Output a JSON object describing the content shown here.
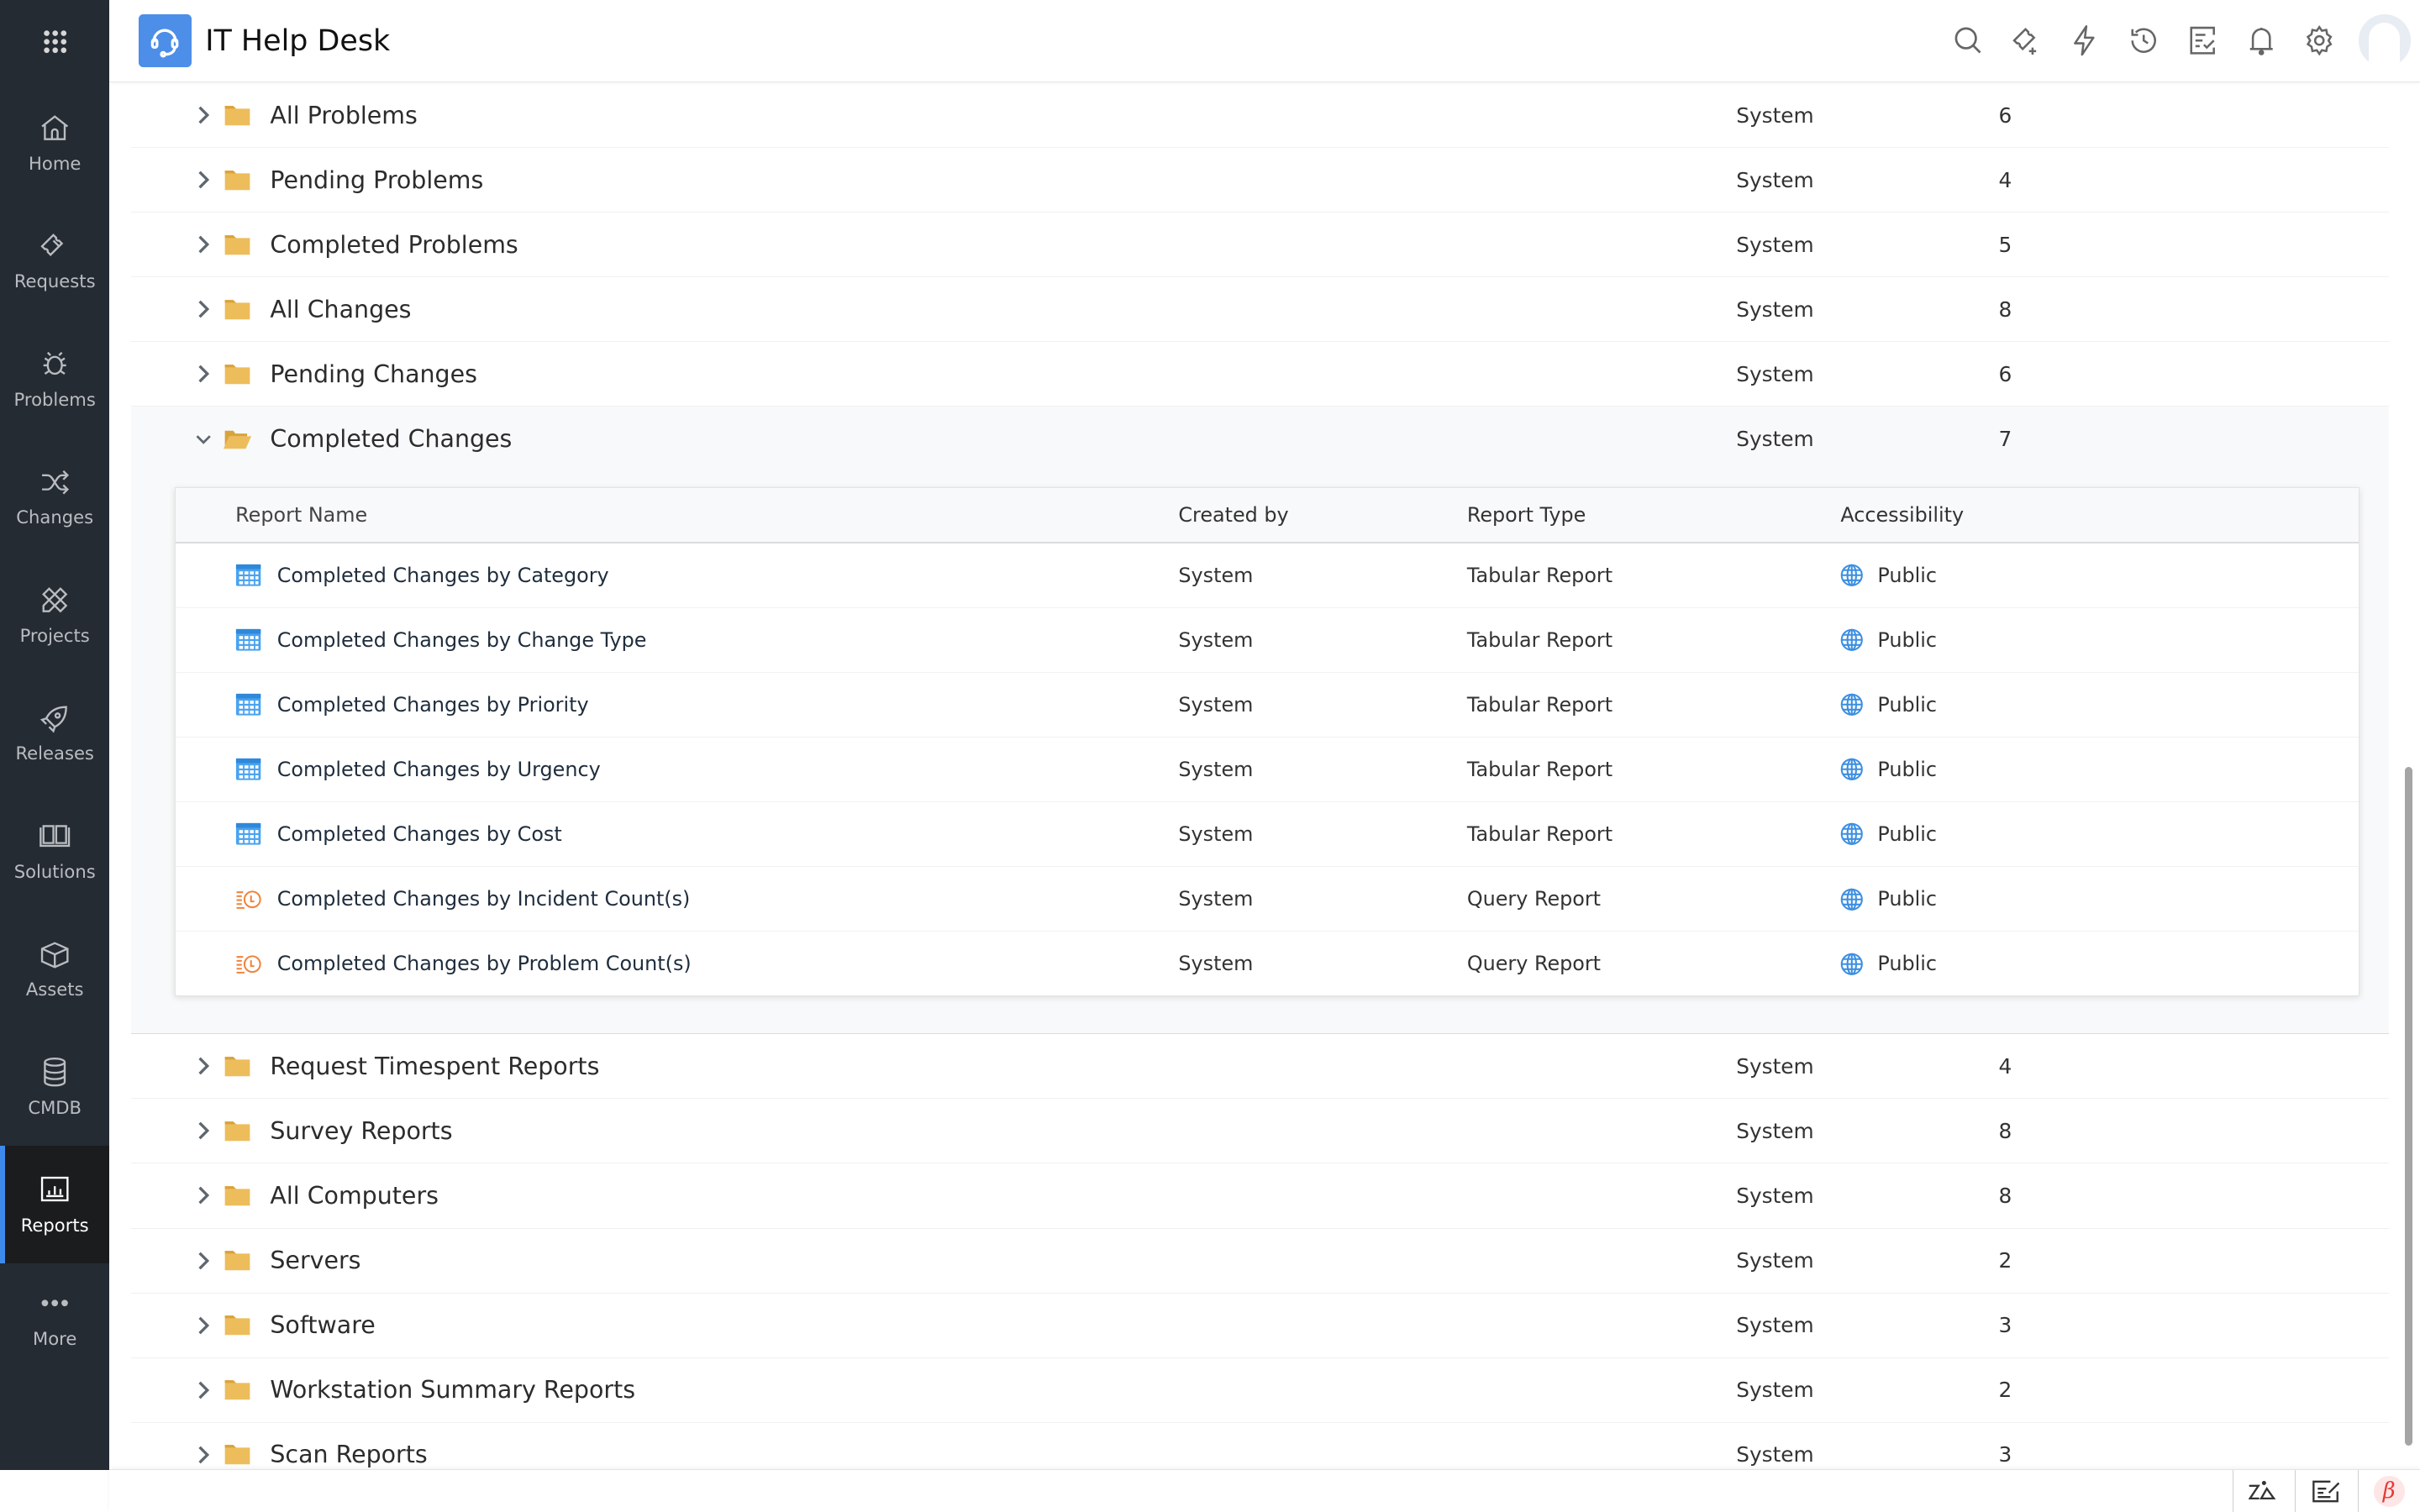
{
  "header": {
    "app_title": "IT Help Desk",
    "icons": [
      "search-icon",
      "new-request-icon",
      "quick-actions-icon",
      "history-icon",
      "tasks-icon",
      "notifications-icon",
      "settings-icon",
      "user-avatar"
    ]
  },
  "sidebar": {
    "items": [
      {
        "label": "Home",
        "icon": "home-icon"
      },
      {
        "label": "Requests",
        "icon": "ticket-icon"
      },
      {
        "label": "Problems",
        "icon": "bug-icon"
      },
      {
        "label": "Changes",
        "icon": "shuffle-icon"
      },
      {
        "label": "Projects",
        "icon": "pencil-ruler-icon"
      },
      {
        "label": "Releases",
        "icon": "rocket-icon"
      },
      {
        "label": "Solutions",
        "icon": "book-icon"
      },
      {
        "label": "Assets",
        "icon": "box-icon"
      },
      {
        "label": "CMDB",
        "icon": "database-icon"
      },
      {
        "label": "Reports",
        "icon": "report-chart-icon",
        "active": true
      },
      {
        "label": "More",
        "icon": "more-dots-icon"
      }
    ]
  },
  "folders_top": [
    {
      "name": "All Problems",
      "owner": "System",
      "count": "6"
    },
    {
      "name": "Pending Problems",
      "owner": "System",
      "count": "4"
    },
    {
      "name": "Completed Problems",
      "owner": "System",
      "count": "5"
    },
    {
      "name": "All Changes",
      "owner": "System",
      "count": "8"
    },
    {
      "name": "Pending Changes",
      "owner": "System",
      "count": "6"
    }
  ],
  "expanded_folder": {
    "name": "Completed Changes",
    "owner": "System",
    "count": "7",
    "columns": [
      "Report Name",
      "Created by",
      "Report Type",
      "Accessibility"
    ],
    "reports": [
      {
        "name": "Completed Changes by Category",
        "created_by": "System",
        "type": "Tabular Report",
        "accessibility": "Public",
        "icon": "tabular-report-icon"
      },
      {
        "name": "Completed Changes by Change Type",
        "created_by": "System",
        "type": "Tabular Report",
        "accessibility": "Public",
        "icon": "tabular-report-icon"
      },
      {
        "name": "Completed Changes by Priority",
        "created_by": "System",
        "type": "Tabular Report",
        "accessibility": "Public",
        "icon": "tabular-report-icon"
      },
      {
        "name": "Completed Changes by Urgency",
        "created_by": "System",
        "type": "Tabular Report",
        "accessibility": "Public",
        "icon": "tabular-report-icon"
      },
      {
        "name": "Completed Changes by Cost",
        "created_by": "System",
        "type": "Tabular Report",
        "accessibility": "Public",
        "icon": "tabular-report-icon"
      },
      {
        "name": "Completed Changes by Incident Count(s)",
        "created_by": "System",
        "type": "Query Report",
        "accessibility": "Public",
        "icon": "query-report-icon"
      },
      {
        "name": "Completed Changes by Problem Count(s)",
        "created_by": "System",
        "type": "Query Report",
        "accessibility": "Public",
        "icon": "query-report-icon"
      }
    ]
  },
  "folders_bottom": [
    {
      "name": "Request Timespent Reports",
      "owner": "System",
      "count": "4"
    },
    {
      "name": "Survey Reports",
      "owner": "System",
      "count": "8"
    },
    {
      "name": "All Computers",
      "owner": "System",
      "count": "8"
    },
    {
      "name": "Servers",
      "owner": "System",
      "count": "2"
    },
    {
      "name": "Software",
      "owner": "System",
      "count": "3"
    },
    {
      "name": "Workstation Summary Reports",
      "owner": "System",
      "count": "2"
    },
    {
      "name": "Scan Reports",
      "owner": "System",
      "count": "3"
    }
  ],
  "footer": {
    "buttons": [
      "zia-icon",
      "notes-icon",
      "beta-icon"
    ],
    "beta_label": "β"
  },
  "colors": {
    "sidebar_bg": "#252b33",
    "active_accent": "#3e8aeb",
    "folder": "#edbd5b",
    "tabular_icon": "#4aa3f0",
    "query_icon": "#f0843a",
    "globe": "#3d8fe0"
  }
}
